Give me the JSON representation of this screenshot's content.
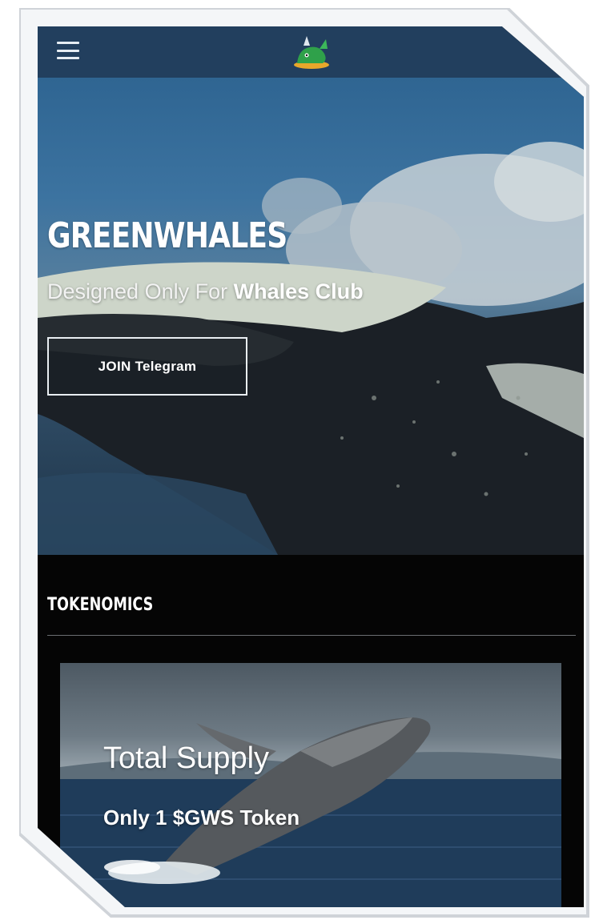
{
  "navbar": {
    "menu_icon": "hamburger-menu-icon",
    "logo_icon": "green-whale-logo-icon"
  },
  "hero": {
    "title": "GREENWHALES",
    "subtitle_prefix": "Designed Only For",
    "subtitle_emphasis": "Whales Club",
    "cta_label": "JOIN Telegram"
  },
  "tokenomics": {
    "heading": "TOKENOMICS",
    "card_title": "Total Supply",
    "card_value": "Only 1 $GWS Token"
  },
  "colors": {
    "navbar": "#223f5e",
    "page_bg": "#050505",
    "text": "#ffffff"
  }
}
